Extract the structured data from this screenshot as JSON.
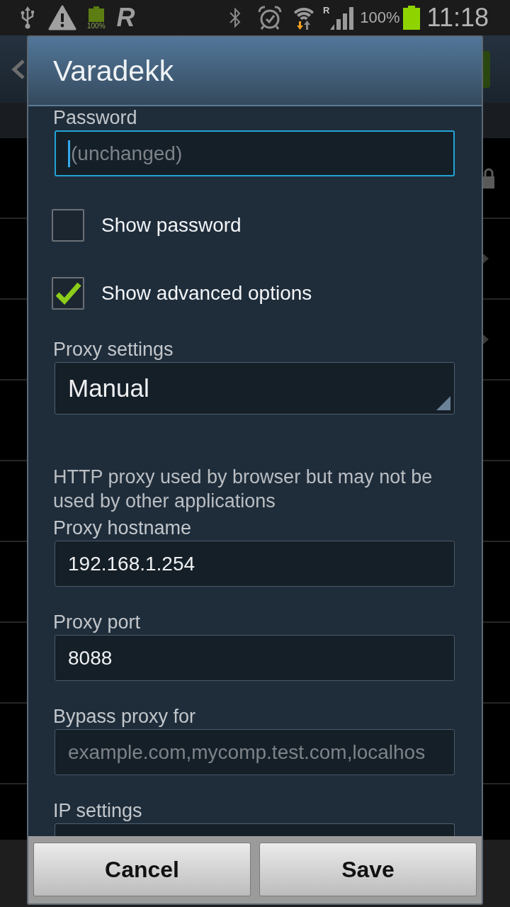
{
  "status_bar": {
    "notice_battery": "100%",
    "app_logo": "R",
    "roaming": "R",
    "battery": "100%",
    "time": "11:18"
  },
  "dialog": {
    "title": "Varadekk",
    "items": [
      {
        "kind": "field",
        "label": "Password",
        "placeholder": "(unchanged)",
        "focused": true
      },
      {
        "kind": "checkbox",
        "label": "Show password",
        "checked": false
      },
      {
        "kind": "checkbox",
        "label": "Show advanced options",
        "checked": true
      },
      {
        "kind": "select",
        "label": "Proxy settings",
        "value": "Manual"
      },
      {
        "kind": "note",
        "text": "HTTP proxy used by browser but may not be used by other applications"
      },
      {
        "kind": "field",
        "label": "Proxy hostname",
        "value": "192.168.1.254",
        "focused": false
      },
      {
        "kind": "field",
        "label": "Proxy port",
        "value": "8088",
        "focused": false
      },
      {
        "kind": "field",
        "label": "Bypass proxy for",
        "placeholder": "example.com,mycomp.test.com,localhos",
        "focused": false
      },
      {
        "kind": "select",
        "label": "IP settings"
      }
    ],
    "buttons": [
      {
        "label": "Cancel"
      },
      {
        "label": "Save"
      }
    ]
  }
}
